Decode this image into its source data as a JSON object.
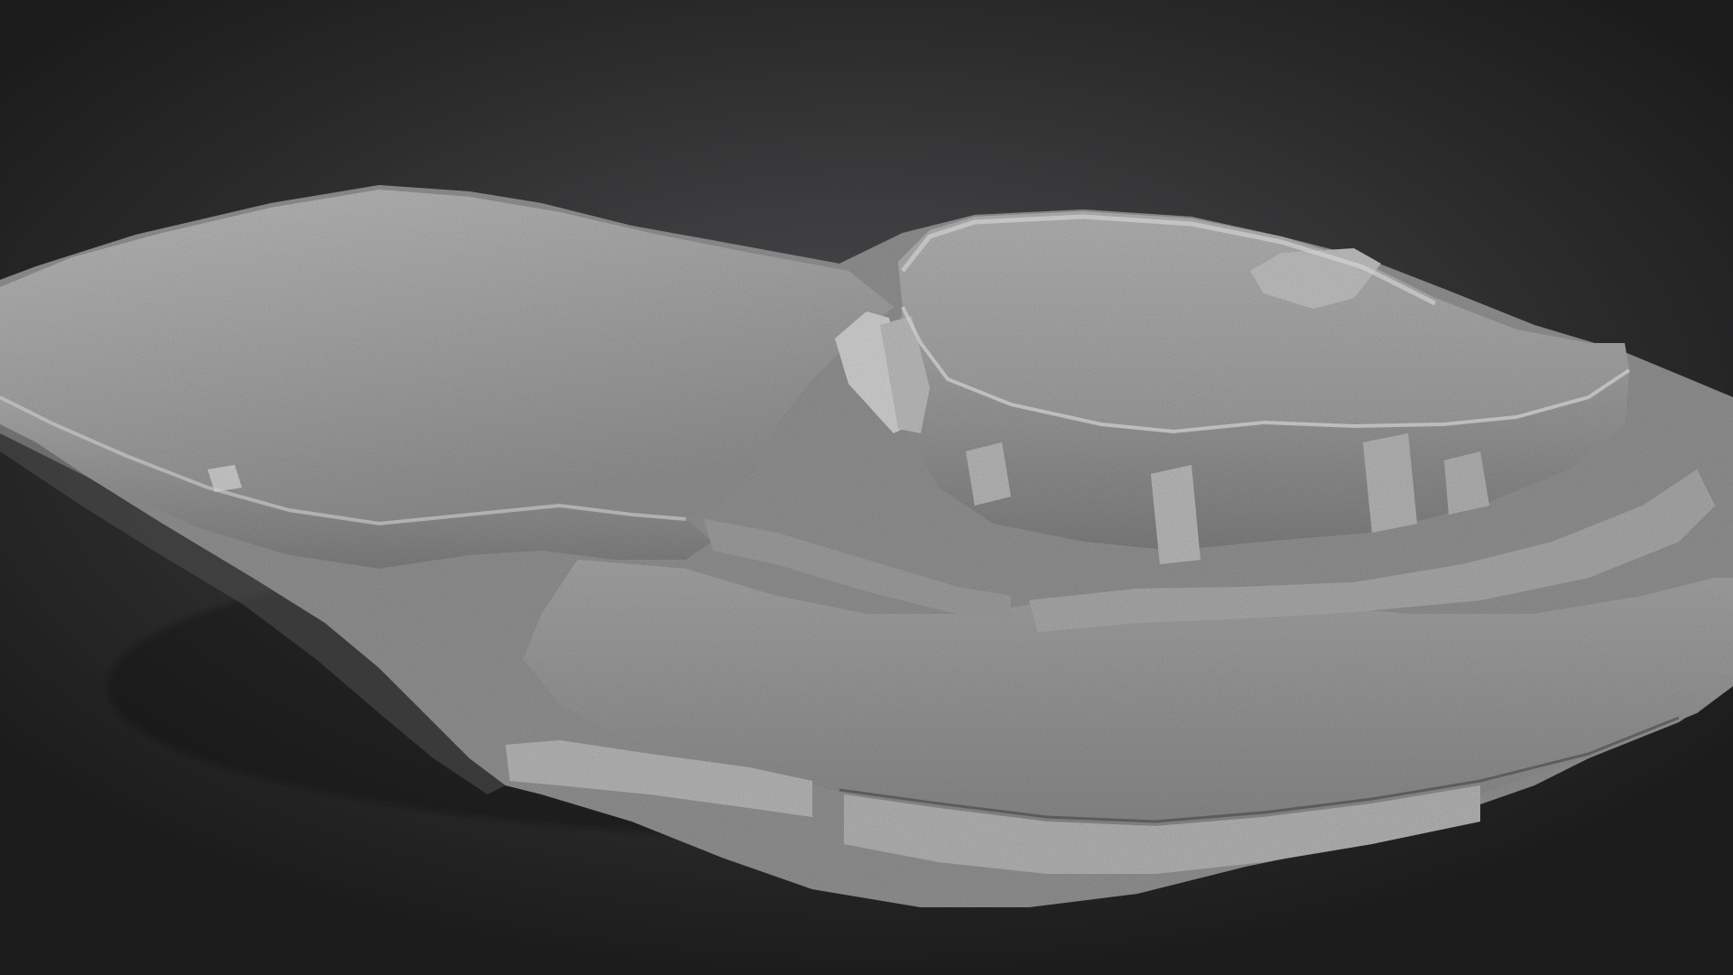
{
  "scene": {
    "subject": "photogrammetry-mesh",
    "colors": {
      "background_center": "#4b4b4d",
      "background_edge": "#1c1c1d",
      "mesh_light": "#c4c4c4",
      "mesh_mid": "#9a9a9a",
      "mesh_dark": "#5a5a5a"
    }
  }
}
